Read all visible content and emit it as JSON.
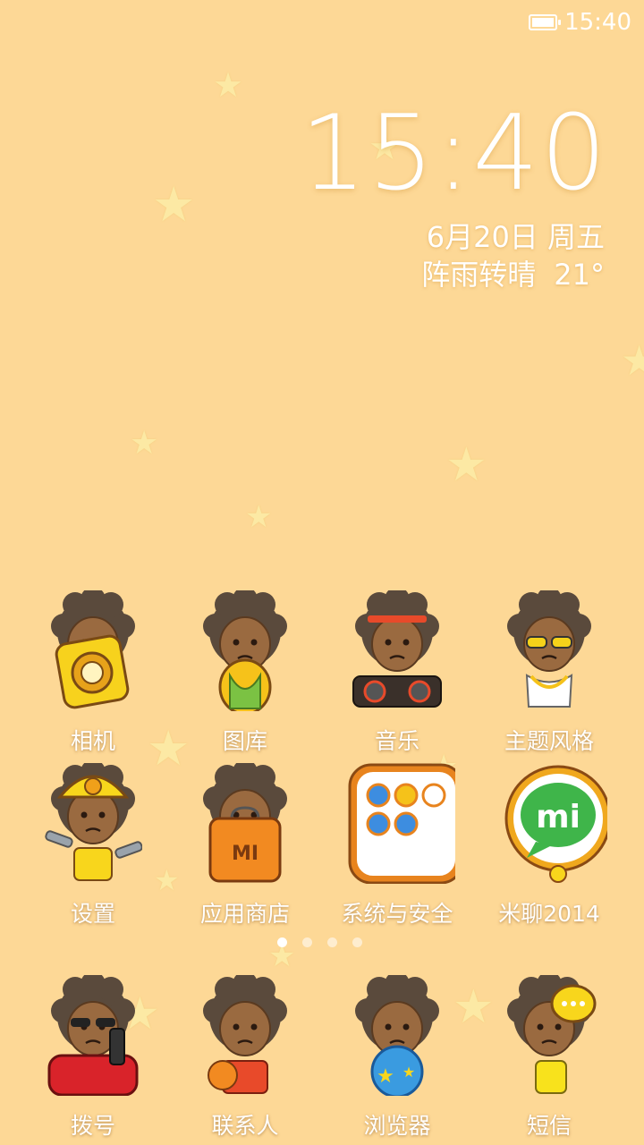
{
  "status_bar": {
    "time": "15:40",
    "battery_icon": "battery-full-icon"
  },
  "clock_widget": {
    "time": "15:40",
    "date": "6月20日",
    "weekday": "周五",
    "weather": "阵雨转晴",
    "temperature": "21°"
  },
  "rows": [
    [
      {
        "label": "相机",
        "icon": "camera-icon"
      },
      {
        "label": "图库",
        "icon": "gallery-icon"
      },
      {
        "label": "音乐",
        "icon": "music-icon"
      },
      {
        "label": "主题风格",
        "icon": "themes-icon"
      }
    ],
    [
      {
        "label": "设置",
        "icon": "settings-icon"
      },
      {
        "label": "应用商店",
        "icon": "app-store-icon"
      },
      {
        "label": "系统与安全",
        "icon": "folder-icon"
      },
      {
        "label": "米聊2014",
        "icon": "miliao-icon"
      }
    ]
  ],
  "page_indicator": {
    "count": 4,
    "active": 0
  },
  "dock": [
    {
      "label": "拨号",
      "icon": "phone-icon"
    },
    {
      "label": "联系人",
      "icon": "contacts-icon"
    },
    {
      "label": "浏览器",
      "icon": "browser-icon"
    },
    {
      "label": "短信",
      "icon": "messages-icon"
    }
  ],
  "colors": {
    "background": "#fdd896",
    "star": "#fce9a4",
    "accent_orange": "#f08a1e"
  }
}
